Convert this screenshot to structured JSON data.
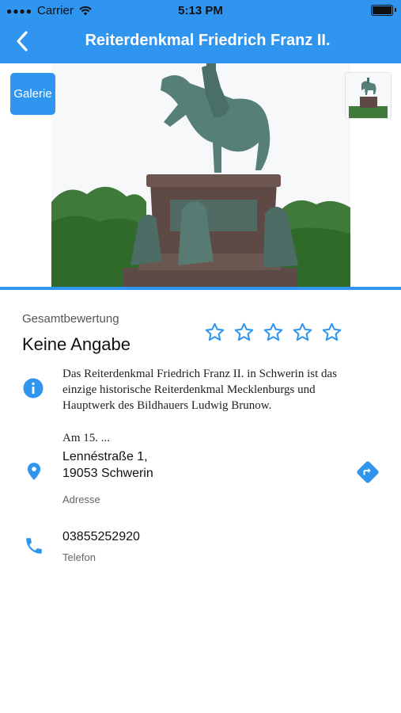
{
  "status_bar": {
    "carrier": "Carrier",
    "time": "5:13 PM"
  },
  "header": {
    "title": "Reiterdenkmal Friedrich Franz II.",
    "back_icon": "back-arrow-icon"
  },
  "hero": {
    "gallery_button": "Galerie",
    "image": "equestrian-statue-photo"
  },
  "rating": {
    "label": "Gesamtbewertung",
    "value": "Keine Angabe",
    "stars_total": 5,
    "stars_filled": 0
  },
  "description": {
    "text": "Das Reiterdenkmal Friedrich Franz II. in Schwerin ist das einzige historische Reiterdenkmal Mecklenburgs und Hauptwerk des Bildhauers Ludwig Brunow.",
    "more": "Am 15. ..."
  },
  "address": {
    "line1": "Lennéstraße 1,",
    "line2": "19053 Schwerin",
    "label": "Adresse"
  },
  "phone": {
    "number": "03855252920",
    "label": "Telefon"
  },
  "colors": {
    "accent": "#2f95ef",
    "text": "#111111",
    "muted": "#666666"
  }
}
